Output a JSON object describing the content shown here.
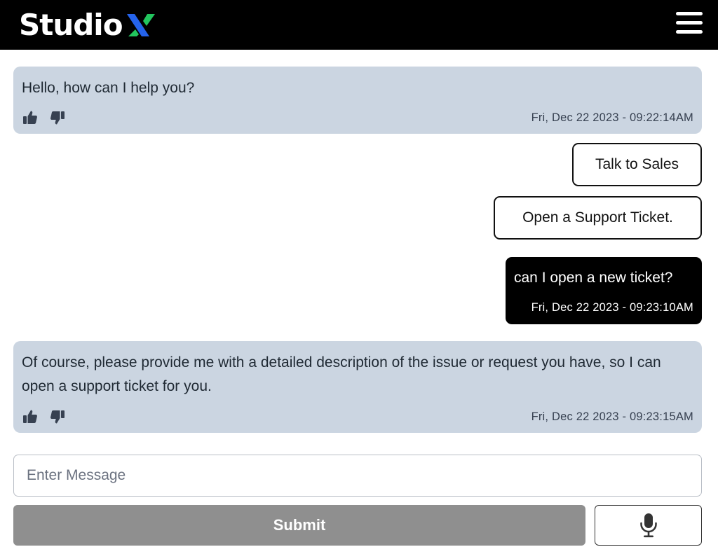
{
  "header": {
    "logo_text": "Studio",
    "logo_mark": "X",
    "logo_colors": {
      "mark_left": "#2563eb",
      "mark_right": "#22c55e"
    },
    "menu_icon": "hamburger-menu-icon"
  },
  "messages": [
    {
      "role": "bot",
      "text": "Hello, how can I help you?",
      "timestamp": "Fri, Dec 22 2023 - 09:22:14AM",
      "icons": [
        "thumbs-up-icon",
        "thumbs-down-icon"
      ]
    },
    {
      "role": "options",
      "options": [
        "Talk to Sales",
        "Open a Support Ticket."
      ]
    },
    {
      "role": "user",
      "text": "can I open a new ticket?",
      "timestamp": "Fri, Dec 22 2023 - 09:23:10AM"
    },
    {
      "role": "bot",
      "text": "Of course, please provide me with a detailed description of the issue or request you have, so I can open a support ticket for you.",
      "timestamp": "Fri, Dec 22 2023 - 09:23:15AM",
      "icons": [
        "thumbs-up-icon",
        "thumbs-down-icon"
      ]
    }
  ],
  "composer": {
    "placeholder": "Enter Message",
    "value": "",
    "submit_label": "Submit",
    "mic_icon": "microphone-icon"
  },
  "colors": {
    "header_bg": "#000000",
    "bot_bubble": "#cbd5e1",
    "user_bubble": "#000000",
    "submit_disabled": "#8f8f8f"
  }
}
